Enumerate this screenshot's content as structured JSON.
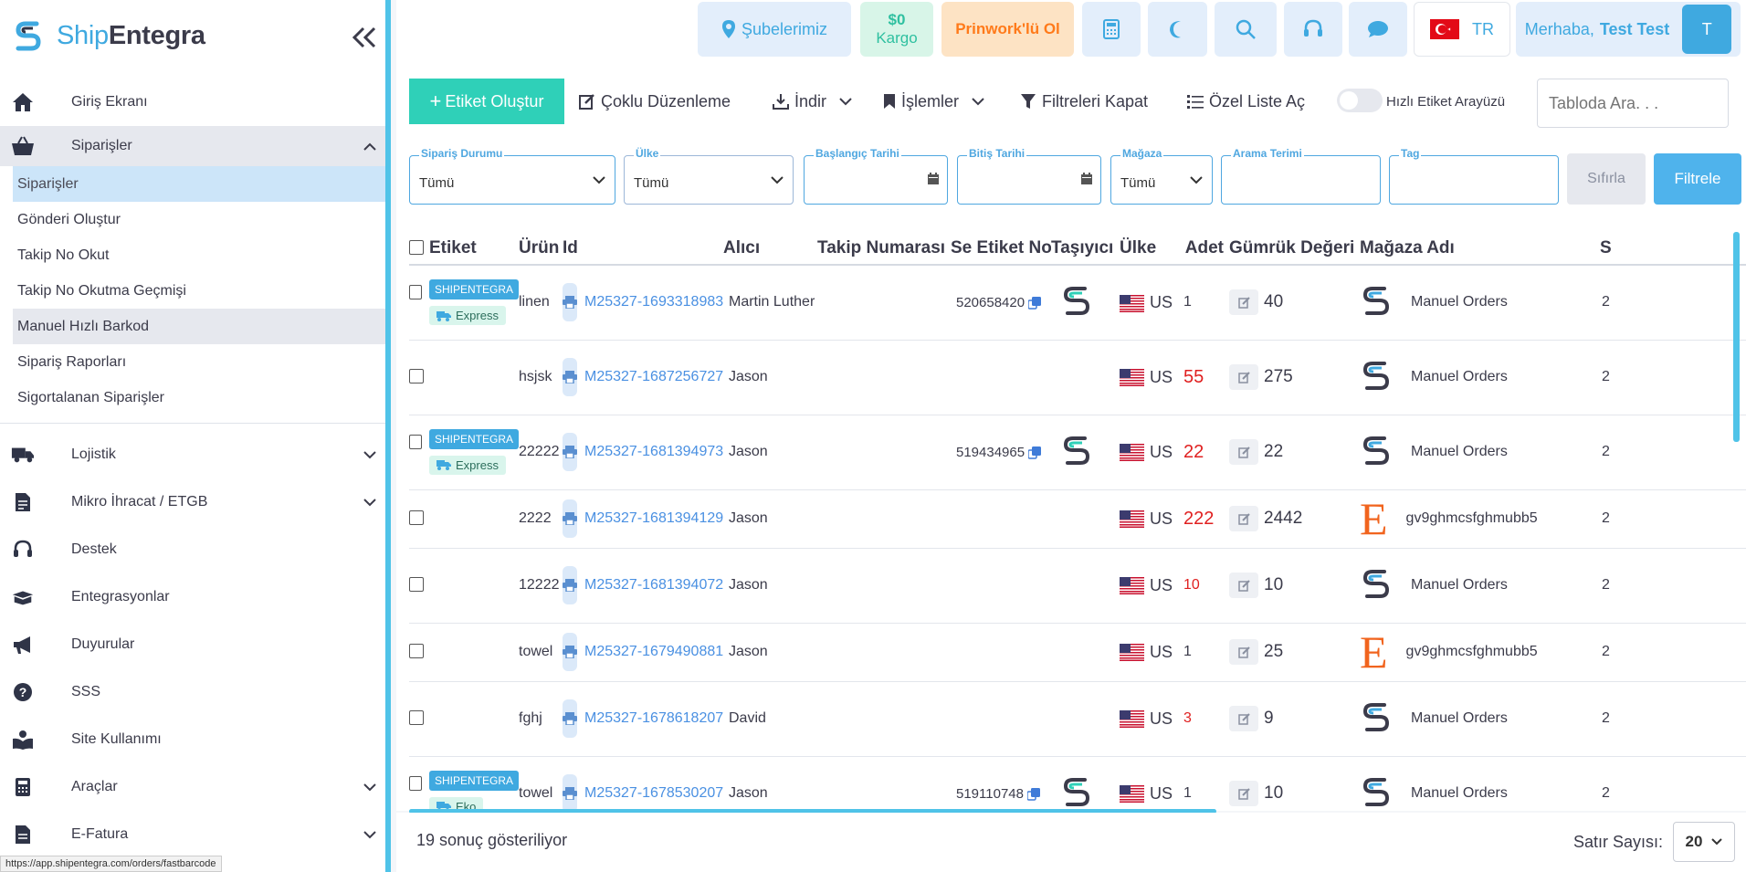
{
  "brand": {
    "part1": "Ship",
    "part2": "Entegra"
  },
  "sidebar": {
    "items": [
      {
        "label": "Giriş Ekranı",
        "icon": "home-icon"
      },
      {
        "label": "Siparişler",
        "icon": "basket-icon"
      },
      {
        "label": "Lojistik",
        "icon": "truck-icon"
      },
      {
        "label": "Mikro İhracat / ETGB",
        "icon": "document-icon"
      },
      {
        "label": "Destek",
        "icon": "headset-icon"
      },
      {
        "label": "Entegrasyonlar",
        "icon": "box-icon"
      },
      {
        "label": "Duyurular",
        "icon": "megaphone-icon"
      },
      {
        "label": "SSS",
        "icon": "question-icon"
      },
      {
        "label": "Site Kullanımı",
        "icon": "book-reader-icon"
      },
      {
        "label": "Araçlar",
        "icon": "calculator-icon"
      },
      {
        "label": "E-Fatura",
        "icon": "invoice-icon"
      }
    ],
    "sub_items": [
      "Siparişler",
      "Gönderi Oluştur",
      "Takip No Okut",
      "Takip No Okutma Geçmişi",
      "Manuel Hızlı Barkod",
      "Sipariş Raporları",
      "Sigortalanan Siparişler"
    ]
  },
  "status_url": "https://app.shipentegra.com/orders/fastbarcode",
  "topbar": {
    "branches": "Şubelerimiz",
    "kargo_amount": "$0",
    "kargo_label": "Kargo",
    "prinwork": "Prinwork'lü Ol",
    "lang": "TR",
    "greeting": "Merhaba,",
    "user_name": "Test Test",
    "avatar_letter": "T"
  },
  "toolbar": {
    "create": "Etiket Oluştur",
    "bulk_edit": "Çoklu Düzenleme",
    "download": "İndir",
    "actions": "İşlemler",
    "close_filters": "Filtreleri Kapat",
    "custom_list": "Özel Liste Aç",
    "fast_label": "Hızlı Etiket Arayüzü",
    "search_placeholder": "Tabloda Ara. . ."
  },
  "filters": {
    "status": {
      "label": "Sipariş Durumu",
      "value": "Tümü"
    },
    "country": {
      "label": "Ülke",
      "value": "Tümü"
    },
    "start": {
      "label": "Başlangıç Tarihi",
      "value": ""
    },
    "end": {
      "label": "Bitiş Tarihi",
      "value": ""
    },
    "store": {
      "label": "Mağaza",
      "value": "Tümü"
    },
    "term": {
      "label": "Arama Terimi",
      "value": ""
    },
    "tag": {
      "label": "Tag",
      "value": ""
    },
    "reset": "Sıfırla",
    "apply": "Filtrele"
  },
  "table": {
    "headers": [
      "Etiket",
      "Ürün",
      "Id",
      "Alıcı",
      "Takip Numarası",
      "Se Etiket No",
      "Taşıyıcı",
      "Ülke",
      "Adet",
      "Gümrük Değeri",
      "Mağaza Adı",
      "S"
    ],
    "rows": [
      {
        "badge": "SHIPENTEGRA",
        "service": "Express",
        "product": "linen",
        "id": "M25327-1693318983",
        "recipient": "Martin Luther",
        "tracking": "",
        "se_no": "520658420",
        "carrier": true,
        "country": "US",
        "qty": "1",
        "qty_red": false,
        "customs": "40",
        "store": "Manuel Orders",
        "store_type": "shipentegra",
        "s": "2"
      },
      {
        "badge": "",
        "service": "",
        "product": "hsjsk",
        "id": "M25327-1687256727",
        "recipient": "Jason",
        "tracking": "",
        "se_no": "",
        "carrier": false,
        "country": "US",
        "qty": "55",
        "qty_red": true,
        "customs": "275",
        "store": "Manuel Orders",
        "store_type": "shipentegra",
        "s": "2"
      },
      {
        "badge": "SHIPENTEGRA",
        "service": "Express",
        "product": "22222",
        "id": "M25327-1681394973",
        "recipient": "Jason",
        "tracking": "",
        "se_no": "519434965",
        "carrier": true,
        "country": "US",
        "qty": "22",
        "qty_red": true,
        "customs": "22",
        "store": "Manuel Orders",
        "store_type": "shipentegra",
        "s": "2"
      },
      {
        "badge": "",
        "service": "",
        "product": "2222",
        "id": "M25327-1681394129",
        "recipient": "Jason",
        "tracking": "",
        "se_no": "",
        "carrier": false,
        "country": "US",
        "qty": "222",
        "qty_red": true,
        "customs": "2442",
        "store": "gv9ghmcsfghmubb5",
        "store_type": "etsy",
        "s": "2"
      },
      {
        "badge": "",
        "service": "",
        "product": "12222",
        "id": "M25327-1681394072",
        "recipient": "Jason",
        "tracking": "",
        "se_no": "",
        "carrier": false,
        "country": "US",
        "qty": "10",
        "qty_red": true,
        "customs": "10",
        "store": "Manuel Orders",
        "store_type": "shipentegra",
        "s": "2"
      },
      {
        "badge": "",
        "service": "",
        "product": "towel",
        "id": "M25327-1679490881",
        "recipient": "Jason",
        "tracking": "",
        "se_no": "",
        "carrier": false,
        "country": "US",
        "qty": "1",
        "qty_red": false,
        "customs": "25",
        "store": "gv9ghmcsfghmubb5",
        "store_type": "etsy",
        "s": "2"
      },
      {
        "badge": "",
        "service": "",
        "product": "fghj",
        "id": "M25327-1678618207",
        "recipient": "David",
        "tracking": "",
        "se_no": "",
        "carrier": false,
        "country": "US",
        "qty": "3",
        "qty_red": true,
        "customs": "9",
        "store": "Manuel Orders",
        "store_type": "shipentegra",
        "s": "2"
      },
      {
        "badge": "SHIPENTEGRA",
        "service": "Eko",
        "product": "towel",
        "id": "M25327-1678530207",
        "recipient": "Jason",
        "tracking": "",
        "se_no": "519110748",
        "carrier": true,
        "country": "US",
        "qty": "1",
        "qty_red": false,
        "customs": "10",
        "store": "Manuel Orders",
        "store_type": "shipentegra",
        "s": "2"
      }
    ]
  },
  "footer": {
    "result": "19 sonuç gösteriliyor",
    "rows_label": "Satır Sayısı:",
    "rows_value": "20"
  },
  "colors": {
    "accent": "#3fa9e0",
    "create": "#2fd0b8",
    "kargo": "#2fc0a0",
    "prinwork": "#ff7a1a",
    "etsy": "#f1641e"
  }
}
